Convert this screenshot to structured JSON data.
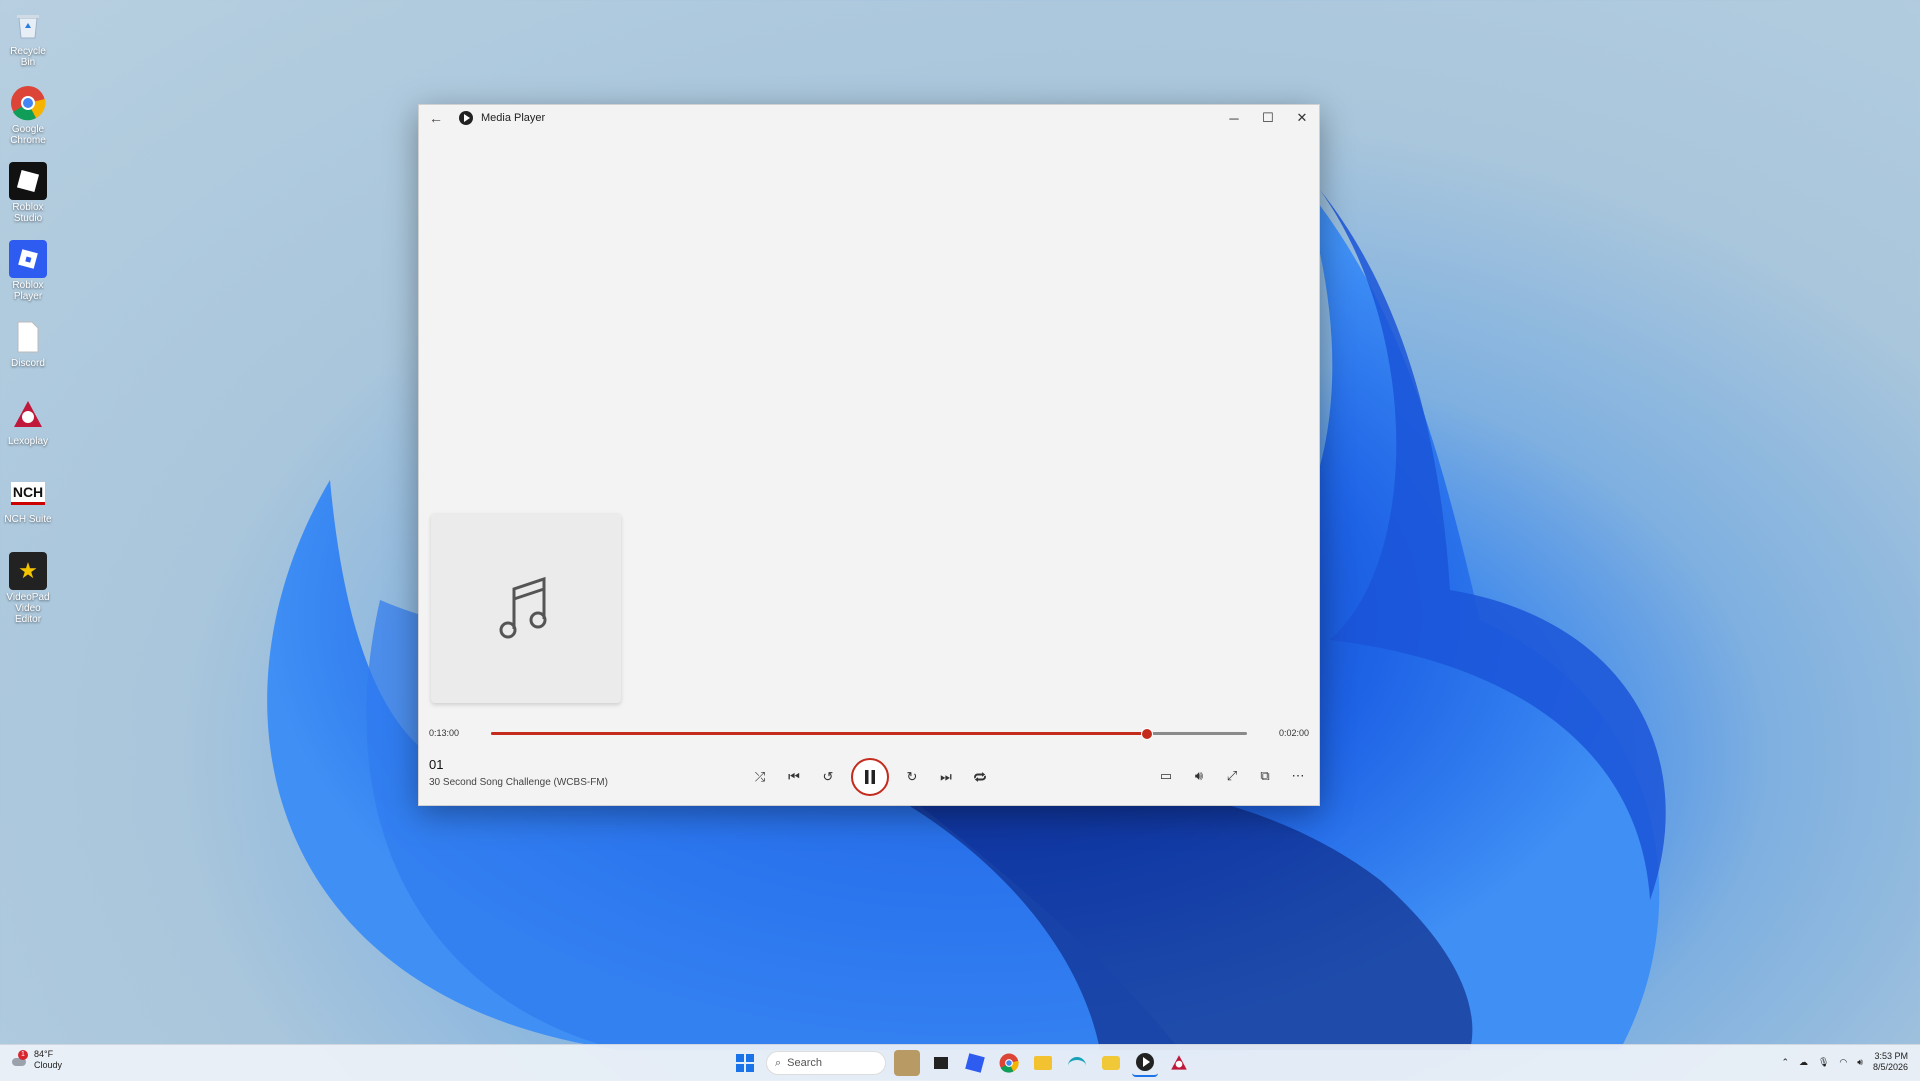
{
  "desktop": {
    "icons": [
      {
        "label": "Recycle Bin",
        "icon": "recycle-bin-icon"
      },
      {
        "label": "Google Chrome",
        "icon": "chrome-icon"
      },
      {
        "label": "Roblox Studio",
        "icon": "roblox-studio-icon"
      },
      {
        "label": "Roblox Player",
        "icon": "roblox-player-icon"
      },
      {
        "label": "Discord",
        "icon": "file-icon"
      },
      {
        "label": "Lexoplay",
        "icon": "lexoplay-icon"
      },
      {
        "label": "NCH Suite",
        "icon": "nch-icon"
      },
      {
        "label": "VideoPad Video Editor",
        "icon": "videopad-icon"
      }
    ]
  },
  "window": {
    "title": "Media Player",
    "elapsed": "0:13:00",
    "remaining": "0:02:00",
    "progress_fraction": 0.867,
    "track_title": "01",
    "track_artist": "30 Second Song Challenge (WCBS-FM)",
    "accent": "#c42b1c"
  },
  "taskbar": {
    "weather_temp": "84°F",
    "weather_desc": "Cloudy",
    "weather_badge": "1",
    "search_placeholder": "Search",
    "time": "3:53 PM",
    "date": "8/5/2026"
  }
}
